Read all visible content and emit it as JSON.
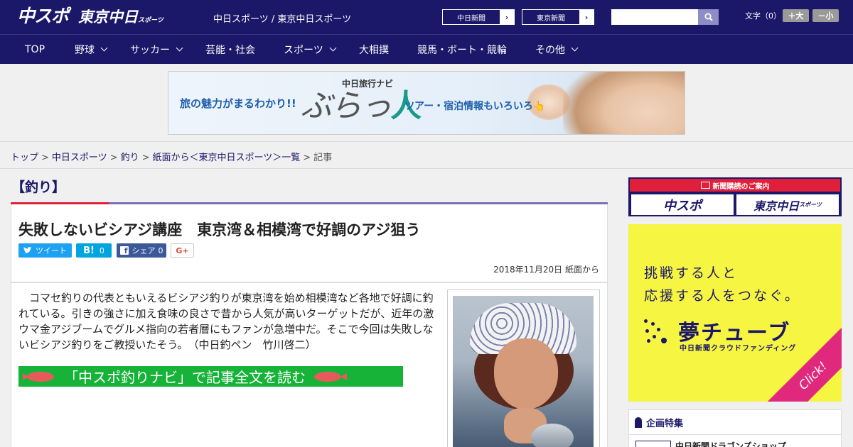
{
  "header": {
    "logo_chunichi": "中スポ",
    "logo_tokyo": "東京中日",
    "logo_tokyo_small": "スポーツ",
    "site_names": "中日スポーツ / 東京中日スポーツ",
    "ext_links": [
      {
        "label": "中日新聞",
        "arrow": "›"
      },
      {
        "label": "東京新聞",
        "arrow": "›"
      }
    ],
    "search_placeholder": "",
    "search_icon": "search-icon",
    "font_size_label": "文字（0）",
    "font_plus": "＋大",
    "font_minus": "－小"
  },
  "nav": {
    "items": [
      {
        "label": "TOP",
        "dropdown": false
      },
      {
        "label": "野球",
        "dropdown": true
      },
      {
        "label": "サッカー",
        "dropdown": true
      },
      {
        "label": "芸能・社会",
        "dropdown": false
      },
      {
        "label": "スポーツ",
        "dropdown": true
      },
      {
        "label": "大相撲",
        "dropdown": false
      },
      {
        "label": "競馬・ボート・競輪",
        "dropdown": false
      },
      {
        "label": "その他",
        "dropdown": true
      }
    ]
  },
  "ad_banner": {
    "left_text": "旅の魅力がまるわかり!!",
    "top_text": "中日旅行ナビ",
    "brand_a": "ぶらっ",
    "brand_b": "人",
    "right_text": "ツアー・宿泊情報もいろいろ👆"
  },
  "breadcrumb": {
    "items": [
      {
        "label": "トップ",
        "link": true
      },
      {
        "label": "中日スポーツ",
        "link": true
      },
      {
        "label": "釣り",
        "link": true
      },
      {
        "label": "紙面から＜東京中日スポーツ＞一覧",
        "link": true
      },
      {
        "label": "記事",
        "link": false
      }
    ],
    "separator": ">"
  },
  "article": {
    "category": "【釣り】",
    "headline": "失敗しないビシアジ講座　東京湾＆相模湾で好調のアジ狙う",
    "share": {
      "tweet": "ツイート",
      "hatena": "B!",
      "hatena_count": "0",
      "facebook": "シェア",
      "facebook_count": "0",
      "gplus": "G+"
    },
    "date": "2018年11月20日 紙面から",
    "lead": "コマセ釣りの代表ともいえるビシアジ釣りが東京湾を始め相模湾など各地で好調に釣れている。引きの強さに加え食味の良さで昔から人気が高いターゲットだが、近年の激ウマ金アジブームでグルメ指向の若者層にもファンが急増中だ。そこで今回は失敗しないビシアジ釣りをご教授いたそう。　（中日釣ペン　竹川啓二）",
    "navi_link": "「中スポ釣りナビ」で記事全文を読む"
  },
  "sidebar": {
    "subscribe_head": "新聞購読のご案内",
    "subscribe_chunichi": "中スポ",
    "subscribe_tokyo": "東京中日",
    "subscribe_tokyo_small": "スポーツ",
    "yume_line1": "挑戦する人と",
    "yume_line2": "応援する人をつなぐ。",
    "yume_brand": "夢チューブ",
    "yume_sub": "中日新聞クラウドファンディング",
    "yume_click": "Click!",
    "special_head": "企画特集",
    "special_item": "中日新聞ドラゴンズショップ"
  },
  "colors": {
    "brand_navy": "#1b1769",
    "accent_red": "#e0203a",
    "navi_green": "#17b339",
    "yume_yellow": "#f5f542",
    "yume_pink": "#e0287d"
  }
}
